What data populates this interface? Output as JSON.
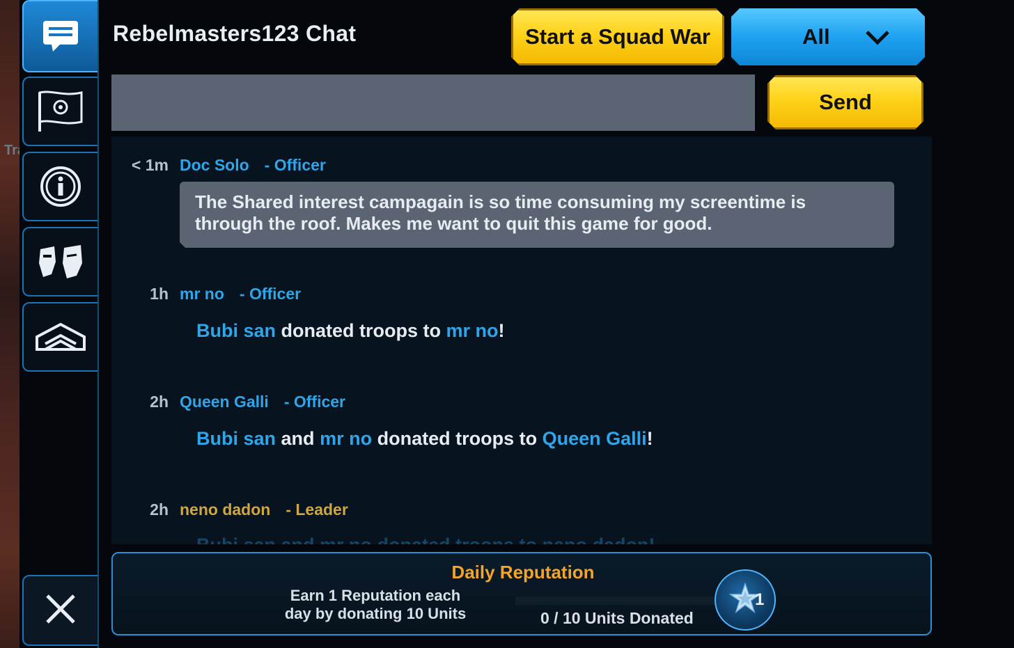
{
  "world": {
    "peek_text": "Tra"
  },
  "sidebar": {
    "tabs": [
      {
        "icon": "chat-icon",
        "active": true
      },
      {
        "icon": "squad-flag-icon",
        "active": false
      },
      {
        "icon": "info-icon",
        "active": false
      },
      {
        "icon": "members-icon",
        "active": false
      },
      {
        "icon": "squad-rank-icon",
        "active": false
      }
    ],
    "close_icon": "close-icon"
  },
  "header": {
    "title": "Rebelmasters123 Chat",
    "squad_war_label": "Start a Squad War",
    "filter_label": "All",
    "send_label": "Send"
  },
  "input": {
    "value": "",
    "placeholder": ""
  },
  "messages": [
    {
      "time": "< 1m",
      "name": "Doc Solo",
      "role": "- Officer",
      "text": "The Shared interest campagain is so time consuming my screentime is through the roof. Makes me want to quit this game for good."
    },
    {
      "time": "1h",
      "name": "mr no",
      "role": "- Officer",
      "donor1": "Bubi san",
      "middle": "donated troops to",
      "target": "mr no",
      "end": "!"
    },
    {
      "time": "2h",
      "name": "Queen Galli",
      "role": "- Officer",
      "donor1": "Bubi san",
      "and": "and",
      "donor2": "mr no",
      "middle": "donated troops to",
      "target": "Queen Galli",
      "end": "!"
    },
    {
      "time": "2h",
      "name": "neno dadon",
      "role": "- Leader",
      "partial": "Bubi san and mr no donated troops to neno dadon!"
    }
  ],
  "reputation": {
    "title": "Daily Reputation",
    "desc_line1": "Earn 1 Reputation each",
    "desc_line2": "day by donating 10 Units",
    "progress_text": "0 / 10 Units Donated",
    "progress_fraction": 0,
    "count": "1",
    "colors": {
      "title": "#f3a42a",
      "accent": "#2fa5ea"
    }
  }
}
